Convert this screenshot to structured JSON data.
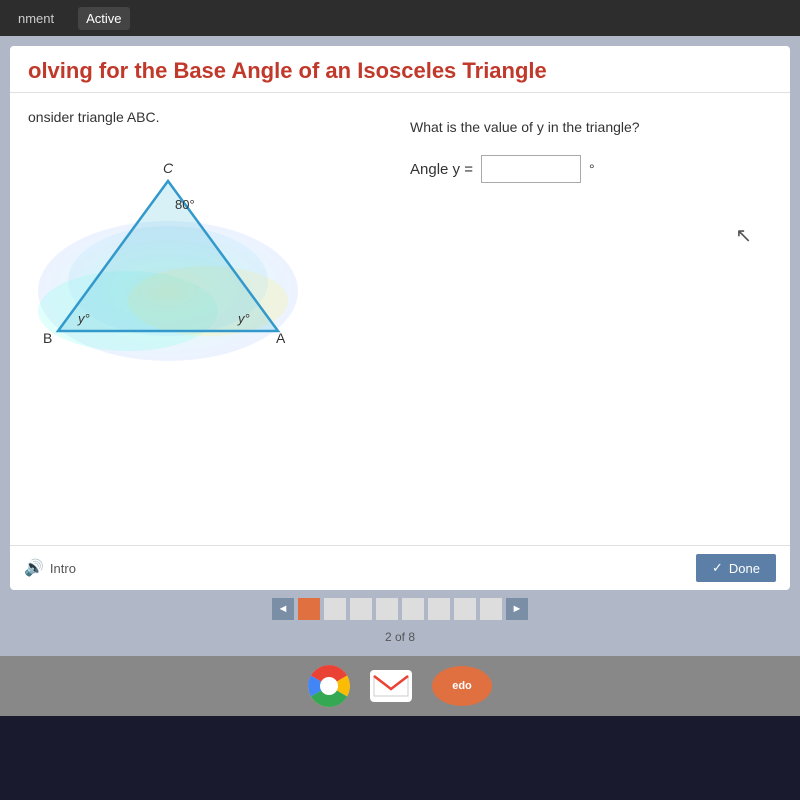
{
  "topbar": {
    "tab1": "nment",
    "tab2": "Active"
  },
  "card": {
    "title": "olving for the Base Angle of an Isosceles Triangle",
    "instruction": "onsider triangle ABC.",
    "question": "What is the value of y in the triangle?",
    "angle_label": "Angle y =",
    "angle_input_placeholder": "",
    "degree": "°",
    "angle_value": "80°",
    "vertex_c": "C",
    "vertex_b": "B",
    "vertex_a": "A",
    "label_y_left": "y°",
    "label_y_right": "y°",
    "intro_button": "Intro",
    "done_button": "Done"
  },
  "pagination": {
    "count_text": "2 of 8",
    "prev": "◄",
    "next": "►",
    "items": [
      "",
      "",
      "",
      "",
      "",
      "",
      "",
      ""
    ],
    "active_index": 0
  },
  "taskbar": {
    "chrome_label": "chrome-icon",
    "gmail_label": "gmail-icon",
    "edu_label": "edo"
  }
}
